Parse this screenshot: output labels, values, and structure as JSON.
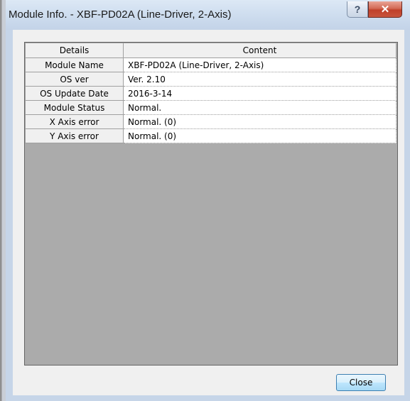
{
  "window": {
    "title": "Module Info. - XBF-PD02A (Line-Driver, 2-Axis)"
  },
  "titlebar_buttons": {
    "help_glyph": "?",
    "close_glyph": "✕"
  },
  "table": {
    "headers": [
      "Details",
      "Content"
    ],
    "rows": [
      {
        "label": "Module Name",
        "value": "XBF-PD02A (Line-Driver, 2-Axis)"
      },
      {
        "label": "OS ver",
        "value": "Ver.  2.10"
      },
      {
        "label": "OS Update Date",
        "value": "2016-3-14"
      },
      {
        "label": "Module Status",
        "value": "Normal."
      },
      {
        "label": "X Axis error",
        "value": "Normal. (0)"
      },
      {
        "label": "Y Axis error",
        "value": "Normal. (0)"
      }
    ]
  },
  "footer": {
    "close_label": "Close"
  },
  "colors": {
    "title_bar": "#cddcee",
    "close_button": "#c0402a",
    "dialog_face": "#f0f0f0"
  },
  "icons": [
    "help-icon",
    "close-icon"
  ]
}
